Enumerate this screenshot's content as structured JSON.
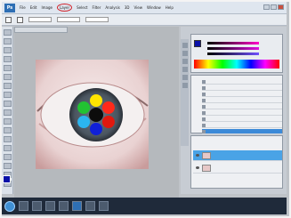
{
  "app": {
    "logo_text": "Ps"
  },
  "menubar": {
    "items": [
      "File",
      "Edit",
      "Image",
      "Layer",
      "Select",
      "Filter",
      "Analysis",
      "3D",
      "View",
      "Window",
      "Help"
    ],
    "circled_item_index": 3
  },
  "document": {
    "tab_label": ""
  },
  "colors": {
    "foreground": "#0a11a8",
    "selection": "#3b8ad8",
    "circle_annotation": "#d2232a"
  },
  "iris_dots": [
    {
      "color": "#ffe500"
    },
    {
      "color": "#ff2a1a"
    },
    {
      "color": "#e1180e"
    },
    {
      "color": "#1020d8"
    },
    {
      "color": "#2bb5f0"
    },
    {
      "color": "#22c232"
    }
  ],
  "history": {
    "rows": [
      "",
      "",
      "",
      "",
      "",
      "",
      "",
      "",
      ""
    ],
    "selected_index": 8
  },
  "layers": {
    "rows": [
      "",
      ""
    ],
    "selected_index": 0
  }
}
